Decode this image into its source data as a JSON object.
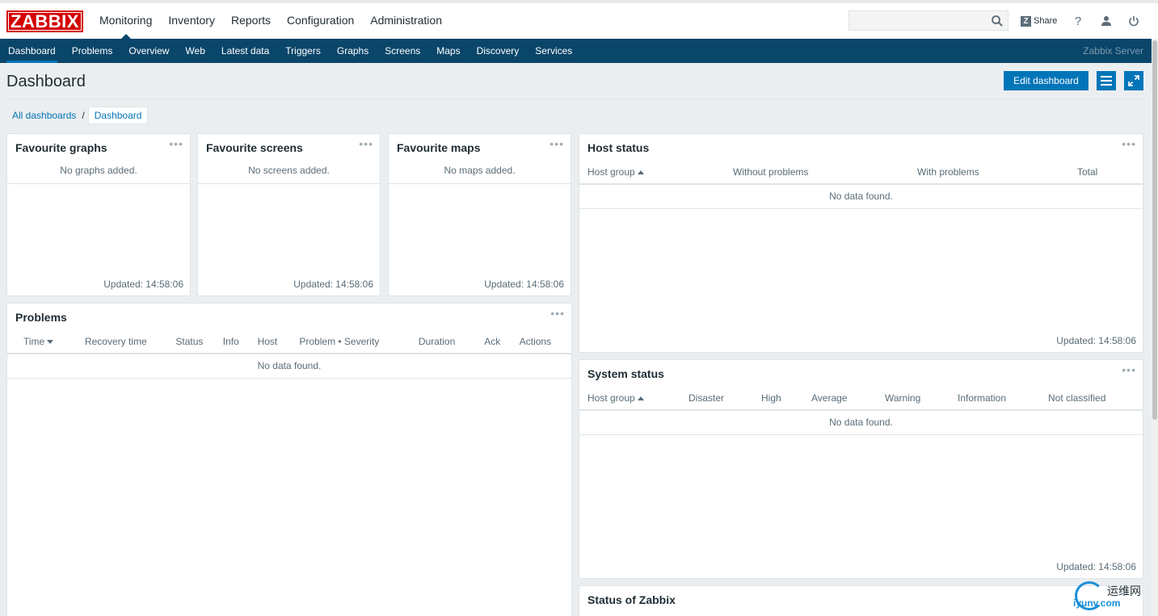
{
  "header": {
    "logo": "ZABBIX",
    "main_nav": [
      "Monitoring",
      "Inventory",
      "Reports",
      "Configuration",
      "Administration"
    ],
    "search_placeholder": "",
    "share_label": "Share",
    "help_glyph": "?"
  },
  "sub_nav": {
    "items": [
      "Dashboard",
      "Problems",
      "Overview",
      "Web",
      "Latest data",
      "Triggers",
      "Graphs",
      "Screens",
      "Maps",
      "Discovery",
      "Services"
    ],
    "server_name": "Zabbix Server"
  },
  "page": {
    "title": "Dashboard",
    "edit_label": "Edit dashboard",
    "breadcrumbs": [
      "All dashboards",
      "Dashboard"
    ]
  },
  "widgets": {
    "fav_graphs": {
      "title": "Favourite graphs",
      "empty": "No graphs added.",
      "updated": "Updated: 14:58:06"
    },
    "fav_screens": {
      "title": "Favourite screens",
      "empty": "No screens added.",
      "updated": "Updated: 14:58:06"
    },
    "fav_maps": {
      "title": "Favourite maps",
      "empty": "No maps added.",
      "updated": "Updated: 14:58:06"
    },
    "problems": {
      "title": "Problems",
      "columns": [
        "Time",
        "Recovery time",
        "Status",
        "Info",
        "Host",
        "Problem • Severity",
        "Duration",
        "Ack",
        "Actions"
      ],
      "empty": "No data found."
    },
    "host_status": {
      "title": "Host status",
      "columns": [
        "Host group",
        "Without problems",
        "With problems",
        "Total"
      ],
      "empty": "No data found.",
      "updated": "Updated: 14:58:06"
    },
    "system_status": {
      "title": "System status",
      "columns": [
        "Host group",
        "Disaster",
        "High",
        "Average",
        "Warning",
        "Information",
        "Not classified"
      ],
      "empty": "No data found.",
      "updated": "Updated: 14:58:06"
    },
    "zabbix_status": {
      "title": "Status of Zabbix"
    },
    "menu_glyph": "•••"
  },
  "watermark": {
    "line1": "运维网",
    "line2": "iyunv.com"
  }
}
